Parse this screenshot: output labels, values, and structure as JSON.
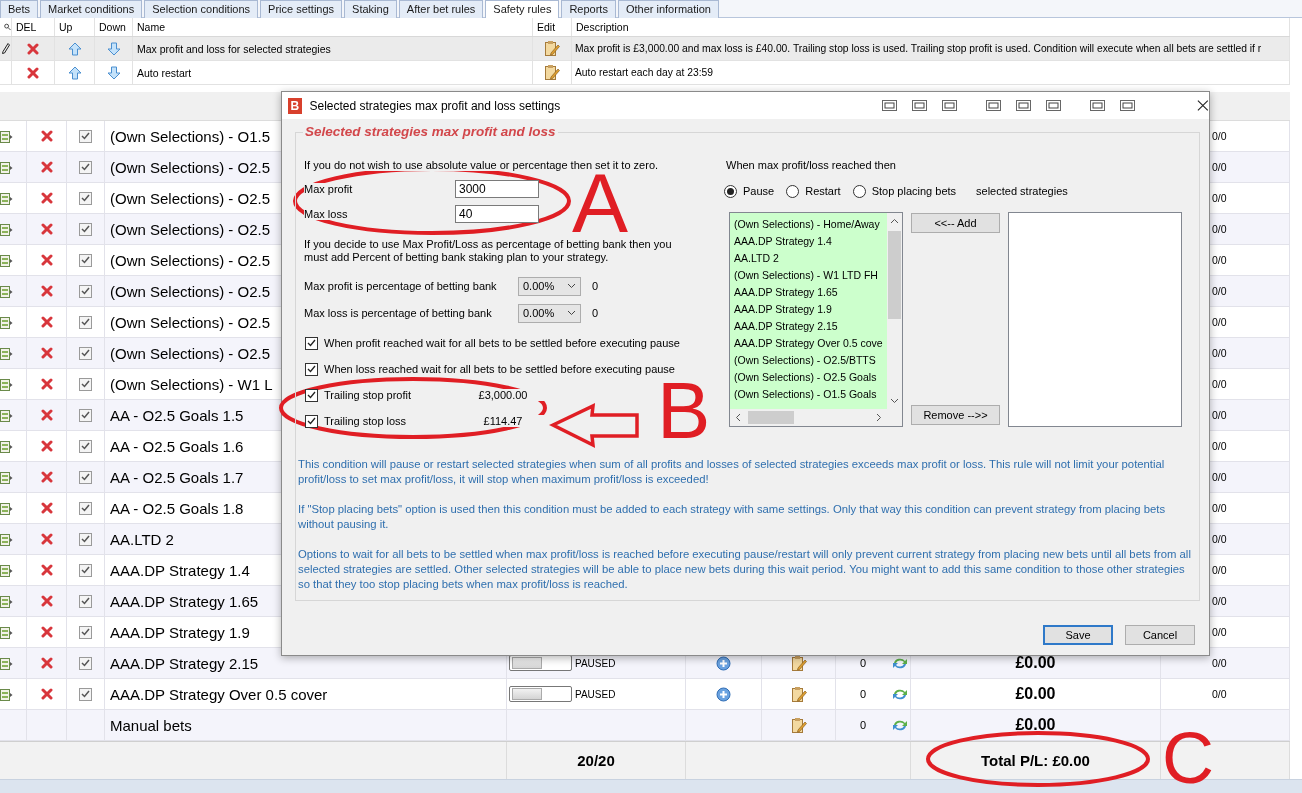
{
  "tabs": [
    {
      "label": "Bets",
      "selected": false
    },
    {
      "label": "Market conditions",
      "selected": false
    },
    {
      "label": "Selection conditions",
      "selected": false
    },
    {
      "label": "Price settings",
      "selected": false
    },
    {
      "label": "Staking",
      "selected": false
    },
    {
      "label": "After bet rules",
      "selected": false
    },
    {
      "label": "Safety rules",
      "selected": true
    },
    {
      "label": "Reports",
      "selected": false
    },
    {
      "label": "Other information",
      "selected": false
    }
  ],
  "rules": {
    "columns": [
      "DEL",
      "Up",
      "Down",
      "Name",
      "Edit",
      "Description"
    ],
    "rows": [
      {
        "name": "Max profit and loss for selected strategies",
        "description": "Max profit is £3,000.00 and max loss is £40.00. Trailing stop loss is used. Trailing stop profit is used. Condition will execute when all bets are settled if r",
        "selected": true
      },
      {
        "name": "Auto restart",
        "description": "Auto restart each day at 23:59",
        "selected": false
      }
    ]
  },
  "strategies": [
    {
      "kind": "strategy",
      "name": "(Own Selections) - O1.5",
      "checked": true,
      "result": "0/0"
    },
    {
      "kind": "strategy",
      "name": "(Own Selections) - O2.5",
      "checked": true,
      "result": "0/0"
    },
    {
      "kind": "strategy",
      "name": "(Own Selections) - O2.5",
      "checked": true,
      "result": "0/0"
    },
    {
      "kind": "strategy",
      "name": "(Own Selections) - O2.5",
      "checked": true,
      "result": "0/0"
    },
    {
      "kind": "strategy",
      "name": "(Own Selections) - O2.5",
      "checked": true,
      "result": "0/0"
    },
    {
      "kind": "strategy",
      "name": "(Own Selections) - O2.5",
      "checked": true,
      "result": "0/0"
    },
    {
      "kind": "strategy",
      "name": "(Own Selections) - O2.5",
      "checked": true,
      "result": "0/0"
    },
    {
      "kind": "strategy",
      "name": "(Own Selections) - O2.5",
      "checked": true,
      "result": "0/0"
    },
    {
      "kind": "strategy",
      "name": "(Own Selections) - W1 L",
      "checked": true,
      "result": "0/0"
    },
    {
      "kind": "strategy",
      "name": "AA - O2.5 Goals 1.5",
      "checked": true,
      "result": "0/0"
    },
    {
      "kind": "strategy",
      "name": "AA - O2.5 Goals 1.6",
      "checked": true,
      "result": "0/0"
    },
    {
      "kind": "strategy",
      "name": "AA - O2.5 Goals 1.7",
      "checked": true,
      "result": "0/0"
    },
    {
      "kind": "strategy",
      "name": "AA - O2.5 Goals 1.8",
      "checked": true,
      "result": "0/0"
    },
    {
      "kind": "strategy",
      "name": "AA.LTD 2",
      "checked": true,
      "result": "0/0"
    },
    {
      "kind": "strategy",
      "name": "AAA.DP Strategy 1.4",
      "checked": true,
      "result": "0/0"
    },
    {
      "kind": "strategy",
      "name": "AAA.DP Strategy 1.65",
      "checked": true,
      "result": "0/0"
    },
    {
      "kind": "strategy",
      "name": "AAA.DP Strategy 1.9",
      "checked": true,
      "result": "0/0"
    },
    {
      "kind": "strategy",
      "name": "AAA.DP Strategy 2.15",
      "checked": true,
      "on": false,
      "status": "PAUSED",
      "count": "0",
      "pl": "£0.00",
      "result": "0/0"
    },
    {
      "kind": "strategy",
      "name": "AAA.DP Strategy Over 0.5 cover",
      "checked": true,
      "on": false,
      "status": "PAUSED",
      "count": "0",
      "pl": "£0.00",
      "result": "0/0"
    },
    {
      "kind": "manual",
      "name": "Manual bets",
      "count": "0",
      "pl": "£0.00"
    }
  ],
  "footer": {
    "count": "20/20",
    "total": "Total P/L: £0.00"
  },
  "dialog": {
    "logo": "B",
    "title": "Selected strategies max profit and loss settings",
    "group_title": "Selected strategies max profit and loss",
    "hint": "If you do not wish to use absolute value or percentage then set it to zero.",
    "fields": [
      {
        "label": "Max profit",
        "value": "3000"
      },
      {
        "label": "Max loss",
        "value": "40"
      }
    ],
    "percent_note": "If you decide to use Max Profit/Loss as percentage of betting bank then you must add Percent of betting bank staking plan to your strategy.",
    "percent_fields": [
      {
        "label": "Max profit is percentage of betting bank",
        "value": "0.00%",
        "result": "0"
      },
      {
        "label": "Max loss is percentage of betting bank",
        "value": "0.00%",
        "result": "0"
      }
    ],
    "options": [
      {
        "label": "When profit reached wait for all bets to be settled before executing pause",
        "checked": true
      },
      {
        "label": "When loss reached wait for all bets to be settled before executing pause",
        "checked": true
      },
      {
        "label": "Trailing stop profit",
        "checked": true,
        "value": "£3,000.00"
      },
      {
        "label": "Trailing stop loss",
        "checked": true,
        "value": "£114.47"
      }
    ],
    "action_heading": "When max profit/loss reached then",
    "actions": [
      {
        "label": "Pause",
        "selected": true
      },
      {
        "label": "Restart",
        "selected": false
      },
      {
        "label": "Stop placing bets",
        "selected": false
      }
    ],
    "action_suffix": "selected strategies",
    "available": [
      "(Own Selections) - Home/Away",
      "AAA.DP Strategy 1.4",
      "AA.LTD 2",
      "(Own Selections) - W1 LTD FH",
      "AAA.DP Strategy 1.65",
      "AAA.DP Strategy 1.9",
      "AAA.DP Strategy 2.15",
      "AAA.DP Strategy Over 0.5 cove",
      "(Own Selections) - O2.5/BTTS",
      "(Own Selections) - O2.5 Goals",
      "(Own Selections) - O1.5 Goals"
    ],
    "add_button": "<<-- Add",
    "remove_button": "Remove -->>",
    "notes": [
      "This condition will pause or restart selected strategies when sum of all profits and losses of selected strategies exceeds max profit or loss. This rule will not limit your potential profit/loss to set max profit/loss, it will stop when maximum profit/loss is exceeded!",
      "If \"Stop placing bets\" option is used then this condition must be added to each strategy with same settings. Only that way this condition can prevent strategy from placing bets without pausing it.",
      "Options to wait for all bets to be settled when max profit/loss is reached before executing pause/restart will only prevent current strategy from placing new bets until all bets from all selected strategies are settled. Other selected strategies will be able to place new bets during this wait period. You might want to add this same condition to those other strategies so that they too stop placing bets when max profit/loss is reached."
    ],
    "buttons": [
      {
        "label": "Save",
        "default": true
      },
      {
        "label": "Cancel",
        "default": false
      }
    ]
  },
  "annotations": [
    {
      "label": "A"
    },
    {
      "label": "B"
    },
    {
      "label": "C"
    }
  ]
}
